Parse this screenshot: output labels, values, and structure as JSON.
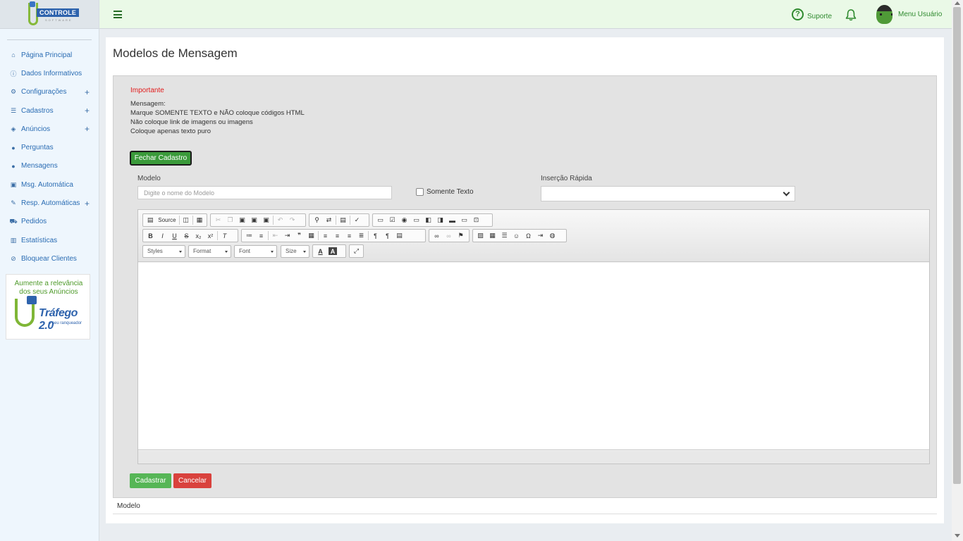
{
  "sidebar": {
    "logo_text": "CONTROLE",
    "logo_sub": "SOFTWARE",
    "items": [
      {
        "label": "Página Principal",
        "icon": "home-icon",
        "glyph": "⌂",
        "expandable": false
      },
      {
        "label": "Dados Informativos",
        "icon": "info-icon",
        "glyph": "ⓘ",
        "expandable": false
      },
      {
        "label": "Configurações",
        "icon": "gear-icon",
        "glyph": "⚙",
        "expandable": true
      },
      {
        "label": "Cadastros",
        "icon": "list-icon",
        "glyph": "☰",
        "expandable": true
      },
      {
        "label": "Anúncios",
        "icon": "tags-icon",
        "glyph": "◈",
        "expandable": true
      },
      {
        "label": "Perguntas",
        "icon": "comment-icon",
        "glyph": "●",
        "expandable": false
      },
      {
        "label": "Mensagens",
        "icon": "comments-icon",
        "glyph": "●",
        "expandable": false
      },
      {
        "label": "Msg. Automática",
        "icon": "robot-icon",
        "glyph": "▣",
        "expandable": false
      },
      {
        "label": "Resp. Automáticas",
        "icon": "magic-icon",
        "glyph": "✎",
        "expandable": true
      },
      {
        "label": "Pedidos",
        "icon": "cart-icon",
        "glyph": "⛟",
        "expandable": false
      },
      {
        "label": "Estatísticas",
        "icon": "chart-icon",
        "glyph": "▥",
        "expandable": false
      },
      {
        "label": "Bloquear Clientes",
        "icon": "ban-icon",
        "glyph": "⊘",
        "expandable": false
      }
    ],
    "banner": {
      "line1": "Aumente a relevância",
      "line2": "dos seus Anúncios",
      "name": "Tráfego 2.0",
      "sub": "o seu ranqueador"
    }
  },
  "header": {
    "support_label": "Suporte",
    "user_menu_label": "Menu Usuário"
  },
  "page": {
    "title": "Modelos de Mensagem",
    "important": "Importante",
    "message_lines": [
      "Mensagem:",
      "Marque SOMENTE TEXTO e NÃO coloque códigos HTML",
      "Não coloque link de imagens ou imagens",
      "Coloque apenas texto puro"
    ],
    "close_button": "Fechar Cadastro",
    "modelo_label": "Modelo",
    "modelo_placeholder": "Digite o nome do Modelo",
    "modelo_value": "",
    "somente_texto_label": "Somente Texto",
    "somente_texto_checked": false,
    "insercao_label": "Inserção Rápida",
    "insercao_value": "",
    "editor": {
      "source_label": "Source",
      "combos": [
        "Styles",
        "Format",
        "Font",
        "Size"
      ]
    },
    "submit_button": "Cadastrar",
    "cancel_button": "Cancelar",
    "table_header": "Modelo"
  },
  "colors": {
    "accent_green": "#3a9a3a",
    "danger_red": "#d9423d",
    "link_blue": "#2a6cb3",
    "header_bg": "#eaf9e7",
    "important_red": "#e21b1b"
  }
}
